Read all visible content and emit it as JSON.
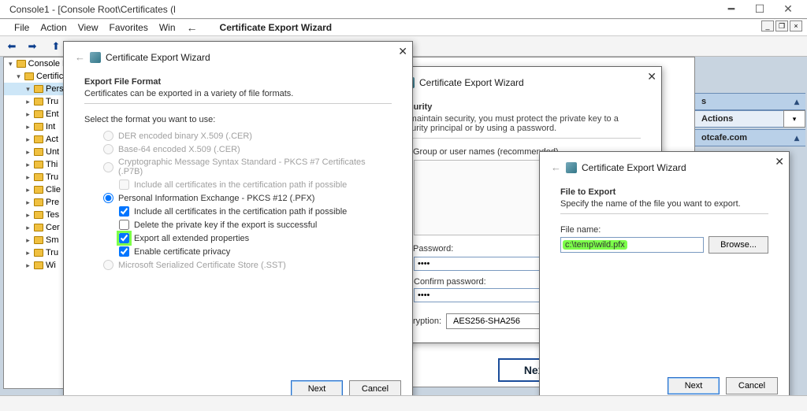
{
  "window": {
    "title": "Console1 - [Console Root\\Certificates (l"
  },
  "menu": {
    "items": [
      "File",
      "Action",
      "View",
      "Favorites",
      "Win"
    ],
    "wizard_label": "Certificate Export Wizard"
  },
  "tree": {
    "root": "Console R",
    "cert": "Certific",
    "pers": "Pers",
    "items": [
      "Tru",
      "Ent",
      "Int",
      "Act",
      "Unt",
      "Thi",
      "Tru",
      "Clie",
      "Pre",
      "Tes",
      "Cer",
      "Sm",
      "Tru",
      "Wi"
    ]
  },
  "right_panel": {
    "row1_label": "s",
    "row2_label": "Actions",
    "row3_label": "otcafe.com"
  },
  "wizard1": {
    "title": "Certificate Export Wizard",
    "heading": "Export File Format",
    "sub": "Certificates can be exported in a variety of file formats.",
    "prompt": "Select the format you want to use:",
    "opt_der": "DER encoded binary X.509 (.CER)",
    "opt_b64": "Base-64 encoded X.509 (.CER)",
    "opt_p7b": "Cryptographic Message Syntax Standard - PKCS #7 Certificates (.P7B)",
    "opt_p7b_chk": "Include all certificates in the certification path if possible",
    "opt_pfx": "Personal Information Exchange - PKCS #12 (.PFX)",
    "pfx_chk1": "Include all certificates in the certification path if possible",
    "pfx_chk2": "Delete the private key if the export is successful",
    "pfx_chk3": "Export all extended properties",
    "pfx_chk4": "Enable certificate privacy",
    "opt_sst": "Microsoft Serialized Certificate Store (.SST)",
    "next": "Next",
    "cancel": "Cancel"
  },
  "wizard2": {
    "title": "Certificate Export Wizard",
    "heading": "Security",
    "sub": "To maintain security, you must protect the private key to a security principal or by using a password.",
    "chk_group": "Group or user names (recommended)",
    "chk_pwd": "Password:",
    "pwd_value": "••••",
    "confirm_label": "Confirm password:",
    "confirm_value": "••••",
    "enc_label": "Encryption:",
    "enc_value": "AES256-SHA256",
    "next": "Next"
  },
  "wizard3": {
    "title": "Certificate Export Wizard",
    "heading": "File to Export",
    "sub": "Specify the name of the file you want to export.",
    "file_label": "File name:",
    "file_value": "c:\\temp\\wild.pfx",
    "browse": "Browse...",
    "next": "Next",
    "cancel": "Cancel"
  }
}
